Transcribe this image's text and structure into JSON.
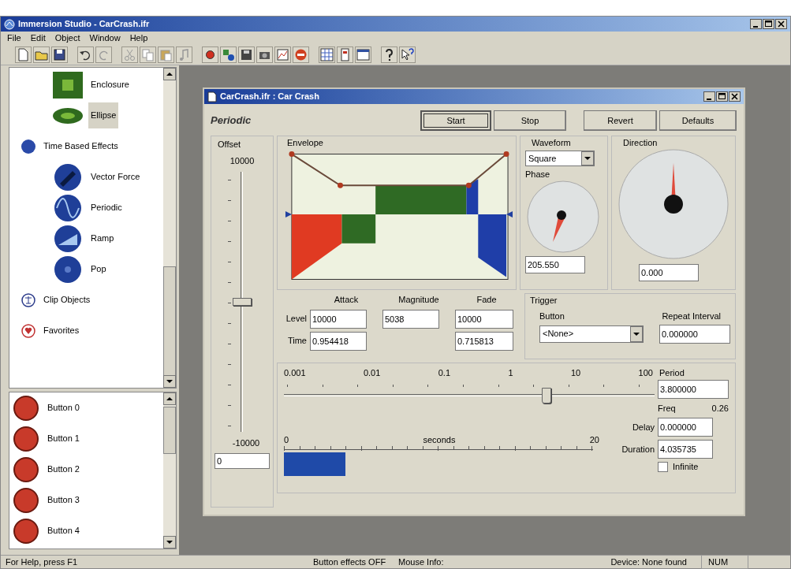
{
  "window": {
    "title": "Immersion Studio - CarCrash.ifr"
  },
  "menu": [
    "File",
    "Edit",
    "Object",
    "Window",
    "Help"
  ],
  "tree": {
    "scrolled_children": [
      {
        "label": "Enclosure",
        "kind": "enclosure",
        "selected": false
      },
      {
        "label": "Ellipse",
        "kind": "ellipse",
        "selected": true
      }
    ],
    "items": [
      {
        "label": "Time Based Effects",
        "kind": "group",
        "selected": false,
        "children": [
          {
            "label": "Vector Force",
            "kind": "vector",
            "selected": false
          },
          {
            "label": "Periodic",
            "kind": "periodic",
            "selected": false
          },
          {
            "label": "Ramp",
            "kind": "ramp",
            "selected": false
          },
          {
            "label": "Pop",
            "kind": "pop",
            "selected": false
          }
        ]
      },
      {
        "label": "Clip Objects",
        "kind": "clip",
        "selected": false
      },
      {
        "label": "Favorites",
        "kind": "favorites",
        "selected": false
      }
    ]
  },
  "button_list": [
    "Button 0",
    "Button 1",
    "Button 2",
    "Button 3",
    "Button 4"
  ],
  "editor": {
    "title": "CarCrash.ifr : Car Crash",
    "effect": "Periodic",
    "buttons": [
      {
        "label": "Start",
        "focused": true
      },
      {
        "label": "Stop",
        "focused": false
      },
      {
        "label": "Revert",
        "focused": false
      },
      {
        "label": "Defaults",
        "focused": false
      }
    ],
    "offset": {
      "label": "Offset",
      "max": "10000",
      "min": "-10000",
      "value": "0",
      "level": 0.5
    },
    "envelope": {
      "label": "Envelope"
    },
    "waveform": {
      "label": "Waveform",
      "value": "Square"
    },
    "phase": {
      "label": "Phase",
      "value": "205.550"
    },
    "direction": {
      "label": "Direction",
      "value": "0.000"
    },
    "params": {
      "columns": [
        "Attack",
        "Magnitude",
        "Fade"
      ],
      "rows": [
        {
          "label": "Level",
          "attack": "10000",
          "magnitude": "5038",
          "fade": "10000"
        },
        {
          "label": "Time",
          "attack": "0.954418",
          "fade": "0.715813"
        }
      ]
    },
    "trigger": {
      "label": "Trigger",
      "button_label": "Button",
      "button_value": "<None>",
      "repeat_label": "Repeat Interval",
      "repeat_value": "0.000000"
    },
    "period": {
      "scale": [
        "0.001",
        "0.01",
        "0.1",
        "1",
        "10",
        "100"
      ],
      "level": 0.71,
      "label": "Period",
      "value": "3.800000",
      "freq_label": "Freq",
      "freq_value": "0.26"
    },
    "timeline": {
      "start": "0",
      "unit": "seconds",
      "end": "20",
      "level": 0.2
    },
    "delay": {
      "label": "Delay",
      "value": "0.000000"
    },
    "duration": {
      "label": "Duration",
      "value": "4.035735"
    },
    "infinite": {
      "label": "Infinite",
      "checked": false
    }
  },
  "status_bar": [
    "For Help, press F1",
    "Button effects OFF",
    "Mouse Info:",
    "Device: None found",
    "NUM"
  ]
}
